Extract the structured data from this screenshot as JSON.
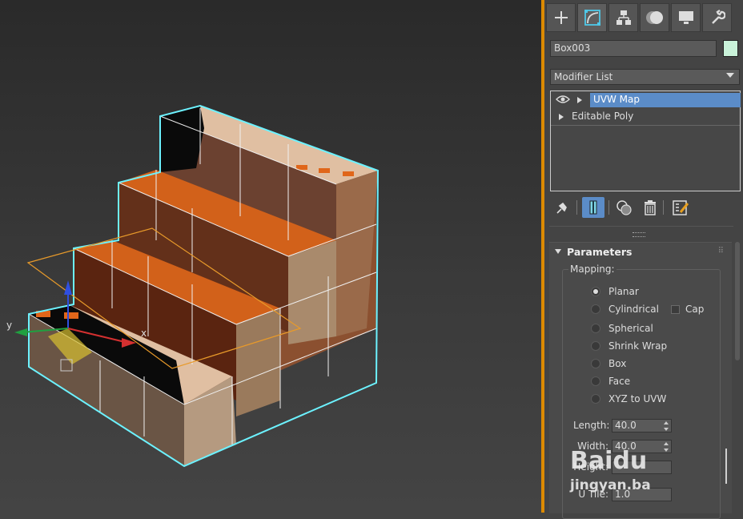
{
  "viewport": {
    "axis_labels": {
      "x": "x",
      "y": "y"
    }
  },
  "command_panel": {
    "tabs": [
      "create-icon",
      "modify-icon",
      "hierarchy-icon",
      "motion-icon",
      "display-icon",
      "utilities-icon"
    ],
    "active_tab": "modify-icon",
    "object_name": "Box003",
    "object_color": "#c9f2d9",
    "modifier_list_label": "Modifier List",
    "stack": [
      {
        "label": "UVW Map",
        "selected": true
      },
      {
        "label": "Editable Poly",
        "selected": false
      }
    ],
    "stack_tools": [
      "pin-stack-icon",
      "show-end-result-icon",
      "make-unique-icon",
      "remove-modifier-icon",
      "configure-modifier-sets-icon"
    ]
  },
  "parameters": {
    "title": "Parameters",
    "mapping_label": "Mapping:",
    "mapping_options": [
      "Planar",
      "Cylindrical",
      "Spherical",
      "Shrink Wrap",
      "Box",
      "Face",
      "XYZ to UVW"
    ],
    "selected_mapping": "Planar",
    "cap_label": "Cap",
    "cap_checked": false,
    "length_label": "Length:",
    "length_value": "40.0",
    "width_label": "Width:",
    "width_value": "40.0",
    "height_label": "Height:",
    "utile_label": "U Tile:",
    "utile_value": "1.0"
  },
  "watermark": {
    "logo": "Baidu",
    "sub": "jingyan.ba"
  },
  "colors": {
    "accent": "#5b8cc8",
    "viewport_divider": "#dc8a00",
    "selection_outline": "#6cf2ff"
  }
}
